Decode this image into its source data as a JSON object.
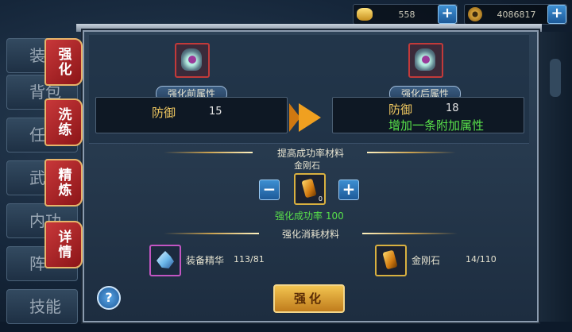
{
  "currency": {
    "gold_ingot": {
      "icon": "gold-ingot-icon",
      "value": "558"
    },
    "copper_coin": {
      "icon": "coin-icon",
      "value": "4086817"
    },
    "add_symbol": "+"
  },
  "side_menu": [
    "装",
    "背包",
    "任",
    "武",
    "内功",
    "阵",
    "技能"
  ],
  "tabs": [
    "强化",
    "洗练",
    "精炼",
    "详情"
  ],
  "before": {
    "header": "强化前属性",
    "attr_name": "防御",
    "attr_value": "15"
  },
  "after": {
    "header": "强化后属性",
    "attr_name": "防御",
    "attr_value": "18",
    "extra": "增加一条附加属性"
  },
  "success_section": {
    "title": "提高成功率材料",
    "item_name": "金刚石",
    "item_count": "0",
    "minus": "−",
    "plus": "+",
    "rate_label": "强化成功率 100"
  },
  "consume_section": {
    "title": "强化消耗材料",
    "items": [
      {
        "name": "装备精华",
        "amount": "113/81"
      },
      {
        "name": "金刚石",
        "amount": "14/110"
      }
    ]
  },
  "enhance_button": "强化",
  "help": "?"
}
